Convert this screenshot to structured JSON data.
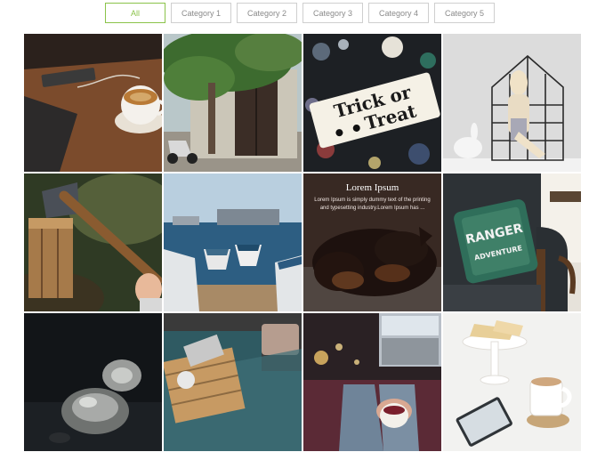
{
  "filters": [
    {
      "label": "All",
      "active": true
    },
    {
      "label": "Category 1",
      "active": false
    },
    {
      "label": "Category 2",
      "active": false
    },
    {
      "label": "Category 3",
      "active": false
    },
    {
      "label": "Category 4",
      "active": false
    },
    {
      "label": "Category 5",
      "active": false
    }
  ],
  "gallery": {
    "tiles": [
      {
        "subject": "coffee cup on wooden desk"
      },
      {
        "subject": "garden gate with tree and scooter"
      },
      {
        "subject": "trick or treat sign"
      },
      {
        "subject": "doll and bunny by grid shelf"
      },
      {
        "subject": "axe in wooden stump"
      },
      {
        "subject": "boats at harbor"
      },
      {
        "subject": "dog sleeping on pillow"
      },
      {
        "subject": "armchair with Ranger pillow"
      },
      {
        "subject": "silver ornament on dark background"
      },
      {
        "subject": "wooden crate table on rug"
      },
      {
        "subject": "person with tea and laptop"
      },
      {
        "subject": "coffee cup with cake stand"
      }
    ],
    "hover_tile": {
      "title": "Lorem Ipsum",
      "text": "Lorem Ipsum is simply dummy text of the printing and typesetting industry.Lorem Ipsum has ..."
    }
  },
  "photo_text": {
    "sign_line1": "Trick or",
    "sign_line2": "Treat",
    "pillow_line1": "RANGER",
    "pillow_line2": "ADVENTURE"
  },
  "colors": {
    "accent": "#8bc34a",
    "button_border": "#cfcfcf",
    "button_text": "#8a8a8a"
  }
}
